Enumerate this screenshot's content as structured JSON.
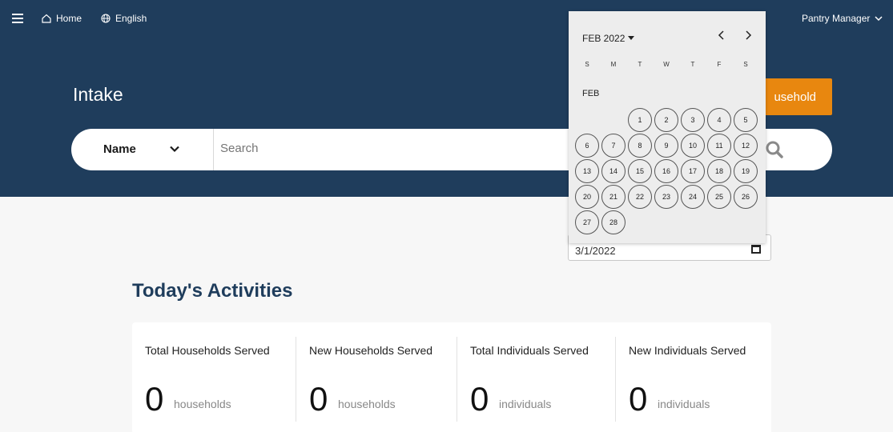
{
  "nav": {
    "home_label": "Home",
    "language_label": "English",
    "user_label": "Pantry Manager"
  },
  "page": {
    "title": "Intake",
    "add_button_label": "usehold"
  },
  "search": {
    "type_label": "Name",
    "placeholder": "Search"
  },
  "date_filter": {
    "value": "3/1/2022"
  },
  "calendar": {
    "month_year": "FEB 2022",
    "month_label": "FEB",
    "weekdays": [
      "S",
      "M",
      "T",
      "W",
      "T",
      "F",
      "S"
    ],
    "first_weekday_index": 2,
    "days": [
      1,
      2,
      3,
      4,
      5,
      6,
      7,
      8,
      9,
      10,
      11,
      12,
      13,
      14,
      15,
      16,
      17,
      18,
      19,
      20,
      21,
      22,
      23,
      24,
      25,
      26,
      27,
      28
    ]
  },
  "activities": {
    "title": "Today's Activities",
    "stats": [
      {
        "label": "Total Households Served",
        "value": "0",
        "unit": "households"
      },
      {
        "label": "New Households Served",
        "value": "0",
        "unit": "households"
      },
      {
        "label": "Total Individuals Served",
        "value": "0",
        "unit": "individuals"
      },
      {
        "label": "New Individuals Served",
        "value": "0",
        "unit": "individuals"
      }
    ]
  },
  "colors": {
    "header_bg": "#1f3d5c",
    "accent": "#e8870f",
    "title": "#1f3d5c"
  }
}
